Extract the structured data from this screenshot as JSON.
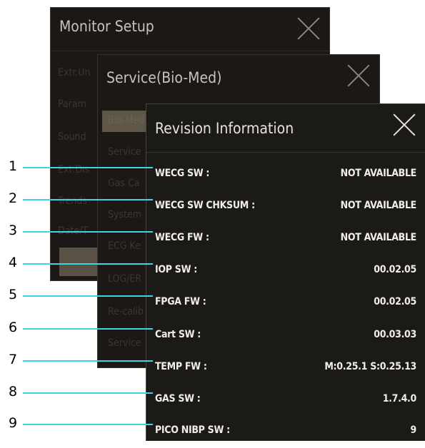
{
  "windows": {
    "monitor_setup": {
      "title": "Monitor Setup",
      "items": [
        "Extr.Un",
        "Param",
        "Sound",
        "Ext.Dis",
        "Trends",
        "Date/T"
      ]
    },
    "service": {
      "title": "Service(Bio-Med)",
      "items": [
        "Bio-Med",
        "Service",
        "Gas Ca",
        "System",
        "ECG Ke",
        "LOG/ER",
        "Re-calib",
        "Service"
      ]
    },
    "revision": {
      "title": "Revision Information",
      "rows": [
        {
          "callout": "1",
          "label": "WECG SW :",
          "value": "NOT AVAILABLE"
        },
        {
          "callout": "2",
          "label": "WECG SW CHKSUM :",
          "value": "NOT AVAILABLE"
        },
        {
          "callout": "3",
          "label": "WECG FW :",
          "value": "NOT AVAILABLE"
        },
        {
          "callout": "4",
          "label": "IOP SW :",
          "value": "00.02.05"
        },
        {
          "callout": "5",
          "label": "FPGA FW :",
          "value": "00.02.05"
        },
        {
          "callout": "6",
          "label": "Cart SW :",
          "value": "00.03.03"
        },
        {
          "callout": "7",
          "label": "TEMP FW :",
          "value": "M:0.25.1 S:0.25.13"
        },
        {
          "callout": "8",
          "label": "GAS SW :",
          "value": "1.7.4.0"
        },
        {
          "callout": "9",
          "label": "PICO NIBP SW :",
          "value": "9"
        }
      ]
    }
  },
  "colors": {
    "callout_line": "#3fd3e4",
    "window_bg": "#1c1a17",
    "text": "#f1eeea"
  }
}
